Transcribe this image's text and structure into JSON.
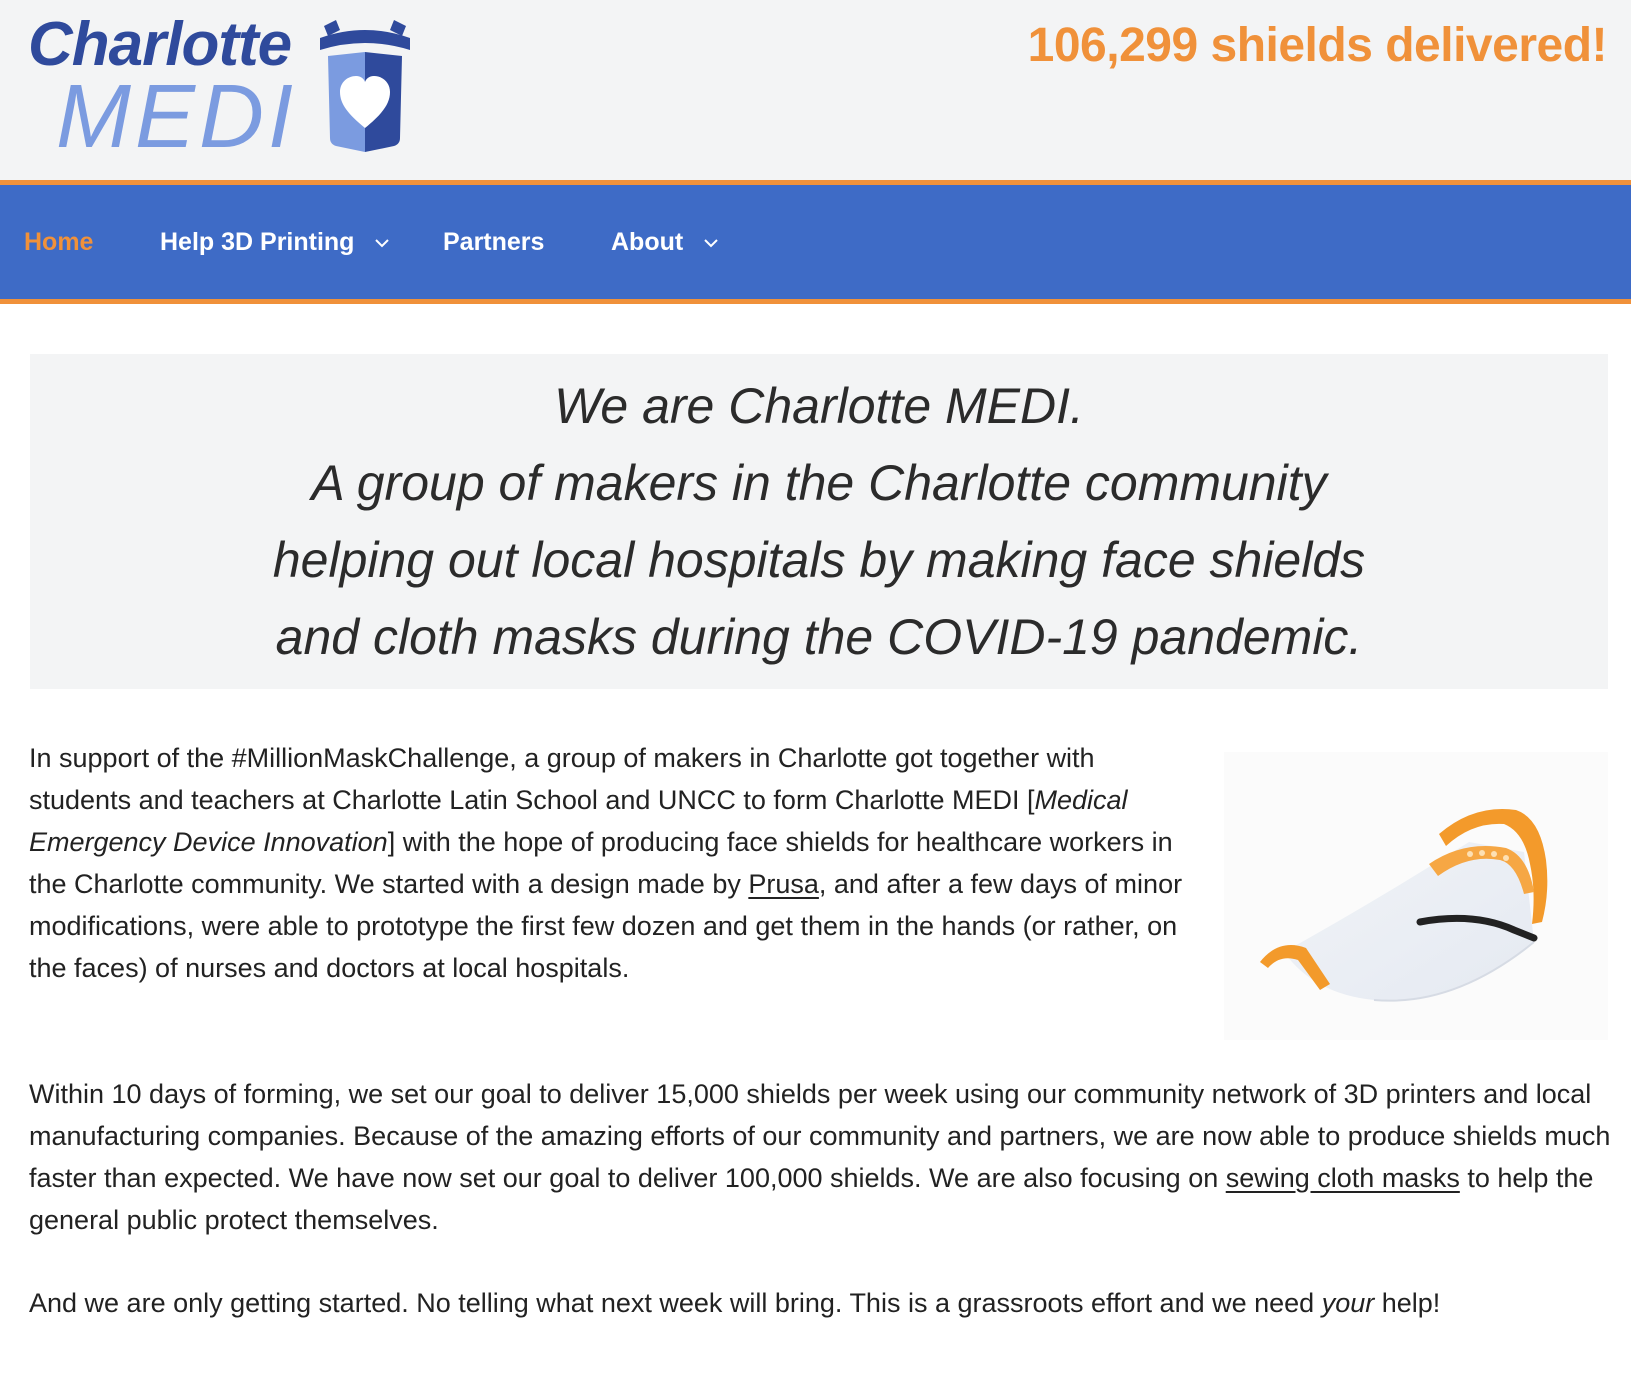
{
  "logo": {
    "line1": "Charlotte",
    "line2": "MEDI"
  },
  "counter": "106,299 shields delivered!",
  "nav": {
    "items": [
      {
        "label": "Home"
      },
      {
        "label": "Help 3D Printing"
      },
      {
        "label": "Partners"
      },
      {
        "label": "About"
      }
    ]
  },
  "hero": {
    "lines": [
      "We are Charlotte MEDI.",
      "A group of makers in the Charlotte community",
      "helping out local hospitals by making face shields",
      "and cloth masks during the COVID-19 pandemic."
    ]
  },
  "content": {
    "p1": {
      "a": "In support of the #MillionMaskChallenge, a group of makers in Charlotte got together with students and teachers at Charlotte Latin School and UNCC to form Charlotte MEDI [",
      "em": "Medical Emergency Device Innovation",
      "b": "] with the hope of producing face shields for healthcare workers in the Charlotte community. We started with a design made by ",
      "link": "Prusa",
      "c": ", and after a few days of minor modifications, were able to prototype the first few dozen and get them in the hands (or rather, on the faces) of nurses and doctors at local hospitals."
    },
    "p2": {
      "a": "Within 10 days of forming, we set our goal to deliver 15,000 shields per week using our community network of 3D printers and local manufacturing companies. Because of the amazing efforts of our community and partners, we are now able to produce shields much faster than expected. We have now set our goal to deliver 100,000 shields. We are also focusing on ",
      "link": "sewing cloth masks",
      "b": " to help the general public protect themselves."
    },
    "p3": {
      "a": "And we are only getting started. No telling what next week will bring. This is a grassroots effort and we need ",
      "em": "your",
      "b": " help!"
    }
  },
  "colors": {
    "accent": "#f0913a",
    "nav_bg": "#3e6bc6",
    "logo_dark": "#2f4a9c",
    "logo_light": "#7b9be0",
    "header_bg": "#f3f4f5"
  }
}
